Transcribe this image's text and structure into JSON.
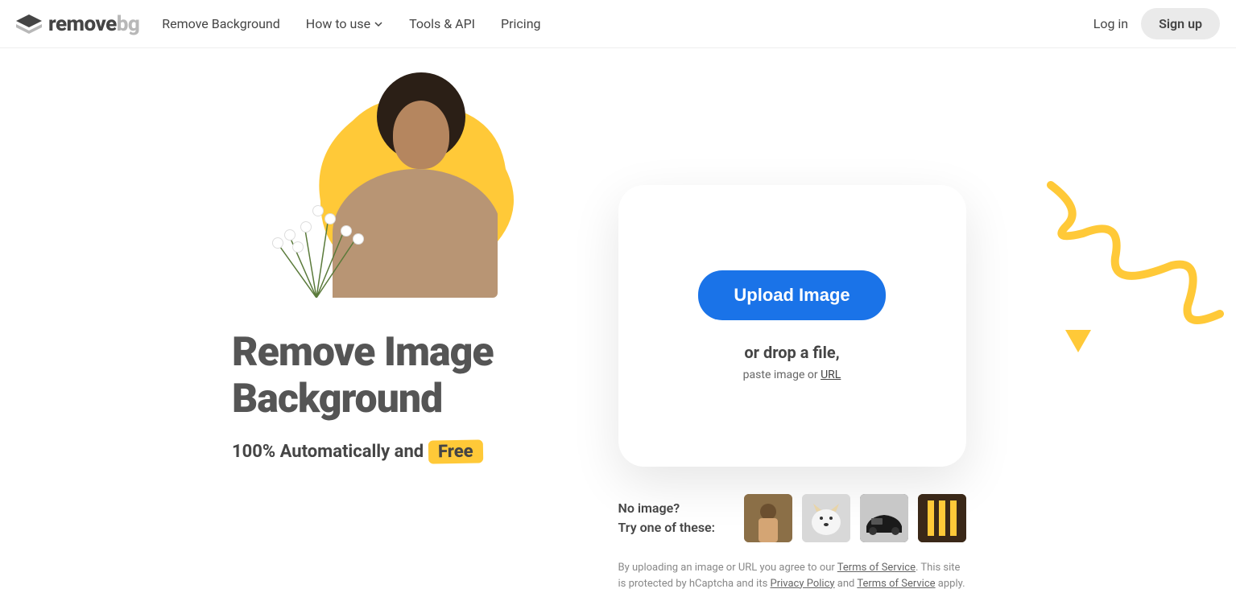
{
  "header": {
    "logo": {
      "text1": "remove",
      "text2": "bg"
    },
    "nav": {
      "remove_bg": "Remove Background",
      "how_to_use": "How to use",
      "tools_api": "Tools & API",
      "pricing": "Pricing"
    },
    "auth": {
      "login": "Log in",
      "signup": "Sign up"
    }
  },
  "hero": {
    "title_line1": "Remove Image",
    "title_line2": "Background",
    "subtitle_prefix": "100% Automatically and",
    "subtitle_badge": "Free"
  },
  "upload": {
    "button": "Upload Image",
    "drop_text": "or drop a file,",
    "paste_prefix": "paste image or ",
    "paste_link": "URL"
  },
  "samples": {
    "line1": "No image?",
    "line2": "Try one of these:"
  },
  "legal": {
    "prefix": "By uploading an image or URL you agree to our ",
    "tos1": "Terms of Service",
    "mid": ". This site is protected by hCaptcha and its ",
    "privacy": "Privacy Policy",
    "and": " and ",
    "tos2": "Terms of Service",
    "suffix": " apply."
  }
}
